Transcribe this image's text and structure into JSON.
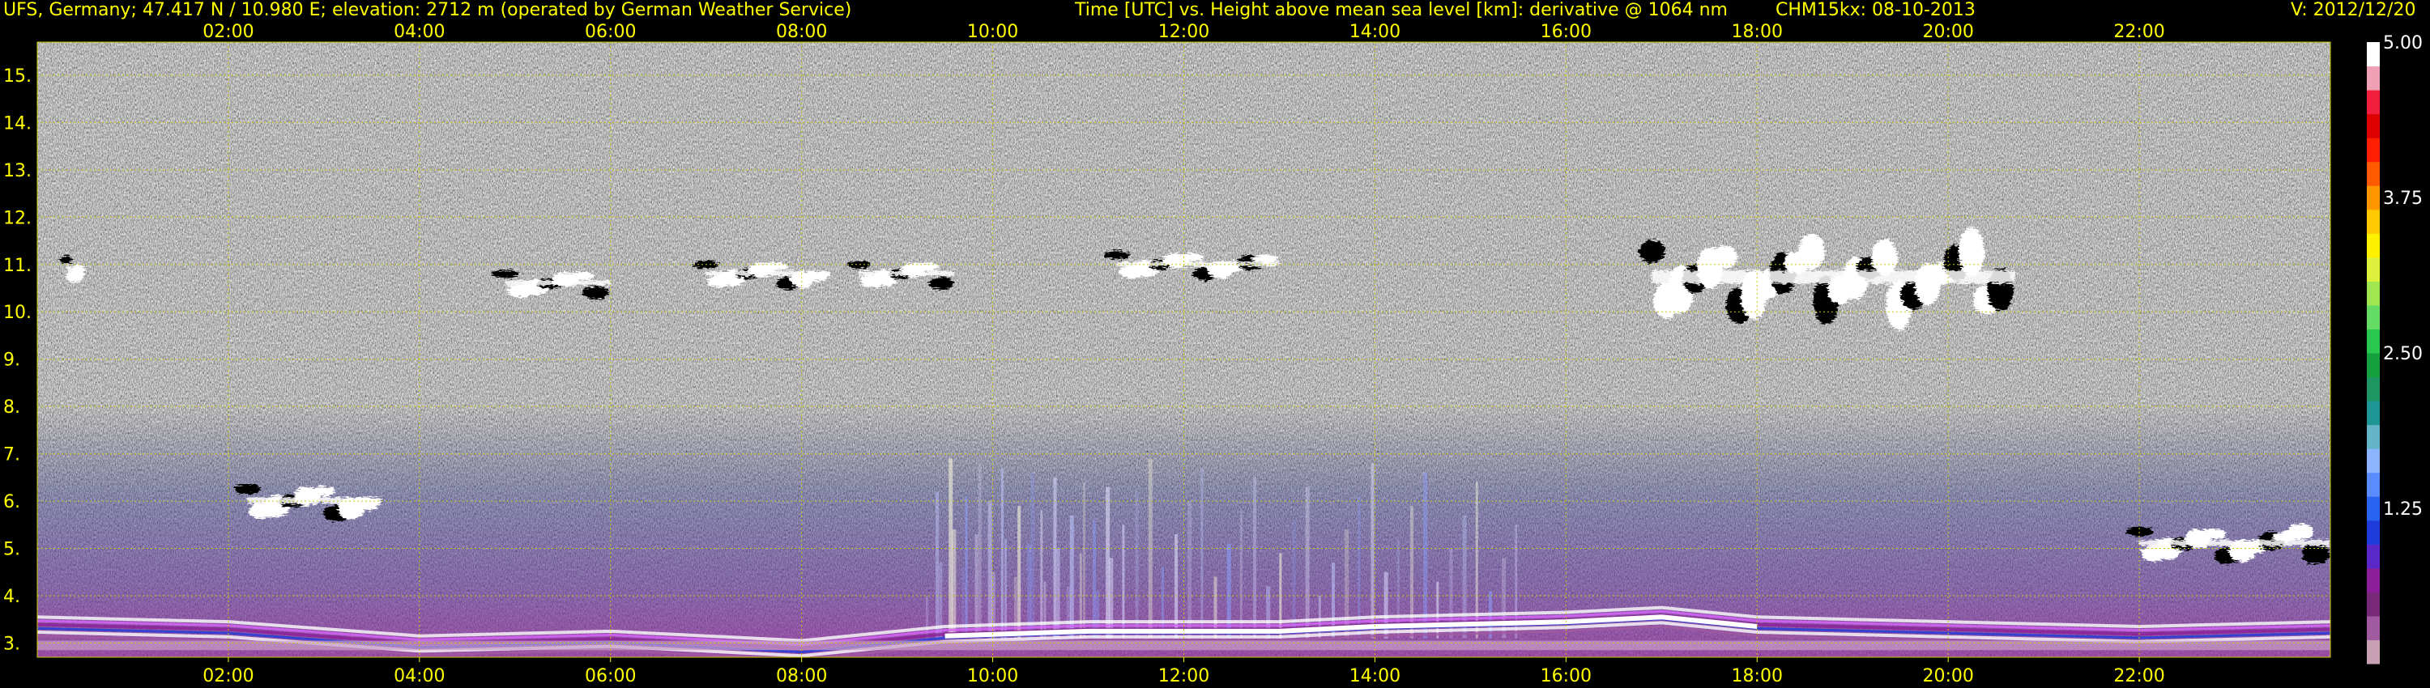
{
  "header": {
    "station": "UFS, Germany; 47.417 N / 10.980 E; elevation: 2712 m  (operated by German Weather Service)",
    "axes_desc": "Time [UTC] vs. Height above mean sea level [km]: derivative @ 1064 nm",
    "instrument": "CHM15kx: 08-10-2013",
    "version": "V: 2012/12/20"
  },
  "colors": {
    "text": "#ffff00",
    "grid": "#cccc00",
    "background": "#000000",
    "colorbar": [
      "#c8a0b4",
      "#a05aa0",
      "#782878",
      "#8c1e9a",
      "#5a28c8",
      "#1e3cdc",
      "#2864f0",
      "#5a8cff",
      "#8cb4ff",
      "#64b4c8",
      "#1e9696",
      "#1e9664",
      "#14a03c",
      "#28c850",
      "#64dc64",
      "#a0e650",
      "#dcf03c",
      "#fff000",
      "#ffc800",
      "#ff9600",
      "#ff5a00",
      "#ff1e00",
      "#dc0000",
      "#f01e3c",
      "#f0a0b4",
      "#ffffff"
    ]
  },
  "chart_data": {
    "type": "heatmap",
    "xlabel": "Time [UTC]",
    "ylabel": "Height above mean sea level [km]",
    "x_unit": "hours UTC",
    "xlim": [
      0,
      24
    ],
    "ylim": [
      2.7,
      15.7
    ],
    "x_ticks": [
      "02:00",
      "04:00",
      "06:00",
      "08:00",
      "10:00",
      "12:00",
      "14:00",
      "16:00",
      "18:00",
      "20:00",
      "22:00"
    ],
    "x_tick_values": [
      2,
      4,
      6,
      8,
      10,
      12,
      14,
      16,
      18,
      20,
      22
    ],
    "y_ticks": [
      "3.",
      "4.",
      "5.",
      "6.",
      "7.",
      "8.",
      "9.",
      "10.",
      "11.",
      "12.",
      "13.",
      "14.",
      "15."
    ],
    "y_tick_values": [
      3,
      4,
      5,
      6,
      7,
      8,
      9,
      10,
      11,
      12,
      13,
      14,
      15
    ],
    "grid": true,
    "colorbar": {
      "min": 0,
      "max": 5,
      "tick_labels": [
        "1.25",
        "2.50",
        "3.75",
        "5.00"
      ],
      "tick_values": [
        1.25,
        2.5,
        3.75,
        5.0
      ]
    },
    "features": {
      "high_clouds": [
        {
          "t_start": 0.3,
          "t_end": 0.5,
          "height_km": 10.9
        },
        {
          "t_start": 4.9,
          "t_end": 6.0,
          "height_km": 10.6
        },
        {
          "t_start": 7.0,
          "t_end": 8.3,
          "height_km": 10.8
        },
        {
          "t_start": 8.6,
          "t_end": 9.6,
          "height_km": 10.8
        },
        {
          "t_start": 11.3,
          "t_end": 13.0,
          "height_km": 11.0
        },
        {
          "t_start": 16.9,
          "t_end": 20.7,
          "height_km": 10.7
        }
      ],
      "mid_clouds": [
        {
          "t_start": 2.2,
          "t_end": 3.6,
          "height_km": 6.0
        },
        {
          "t_start": 22.0,
          "t_end": 24.0,
          "height_km": 5.1
        }
      ],
      "boundary_layer_top_km": [
        {
          "t": 0,
          "h": 3.6
        },
        {
          "t": 2,
          "h": 3.5
        },
        {
          "t": 4,
          "h": 3.2
        },
        {
          "t": 6,
          "h": 3.3
        },
        {
          "t": 8,
          "h": 3.1
        },
        {
          "t": 9.5,
          "h": 3.4
        },
        {
          "t": 11,
          "h": 3.5
        },
        {
          "t": 13,
          "h": 3.5
        },
        {
          "t": 14,
          "h": 3.6
        },
        {
          "t": 16,
          "h": 3.7
        },
        {
          "t": 17,
          "h": 3.8
        },
        {
          "t": 18,
          "h": 3.6
        },
        {
          "t": 20,
          "h": 3.5
        },
        {
          "t": 22,
          "h": 3.4
        },
        {
          "t": 24,
          "h": 3.5
        }
      ]
    }
  }
}
